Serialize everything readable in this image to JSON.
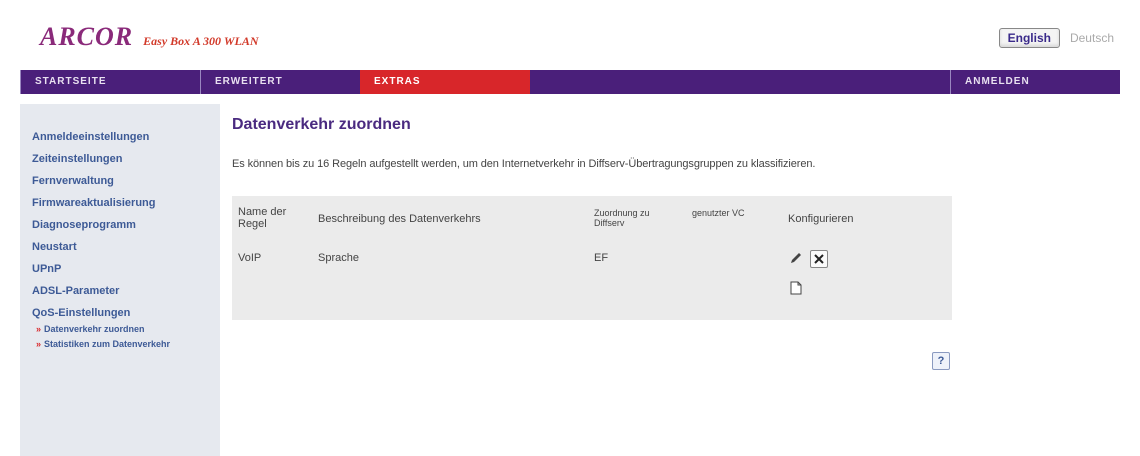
{
  "header": {
    "logo": "ARCOR",
    "logo_subtitle": "Easy Box A 300 WLAN",
    "lang_english": "English",
    "lang_deutsch": "Deutsch"
  },
  "nav": {
    "items": [
      "STARTSEITE",
      "ERWEITERT",
      "EXTRAS"
    ],
    "login": "ANMELDEN",
    "active": "EXTRAS"
  },
  "sidebar": {
    "items": [
      "Anmeldeeinstellungen",
      "Zeiteinstellungen",
      "Fernverwaltung",
      "Firmwareaktualisierung",
      "Diagnoseprogramm",
      "Neustart",
      "UPnP",
      "ADSL-Parameter",
      "QoS-Einstellungen"
    ],
    "subitems": [
      "Datenverkehr zuordnen",
      "Statistiken zum Datenverkehr"
    ]
  },
  "main": {
    "title": "Datenverkehr zuordnen",
    "intro": "Es können bis zu 16 Regeln aufgestellt werden, um den Internetverkehr in Diffserv-Übertragungsgruppen zu klassifizieren.",
    "table": {
      "headers": {
        "name": "Name der Regel",
        "desc": "Beschreibung des Datenverkehrs",
        "assign": "Zuordnung zu Diffserv",
        "vc": "genutzter VC",
        "config": "Konfigurieren"
      },
      "rows": [
        {
          "name": "VoIP",
          "desc": "Sprache",
          "assign": "EF",
          "vc": ""
        }
      ]
    },
    "help": "?"
  },
  "colors": {
    "nav_bg": "#4a1f7a",
    "nav_active": "#d8262a",
    "sidebar_bg": "#e6e9ef",
    "link": "#3d5a96"
  }
}
